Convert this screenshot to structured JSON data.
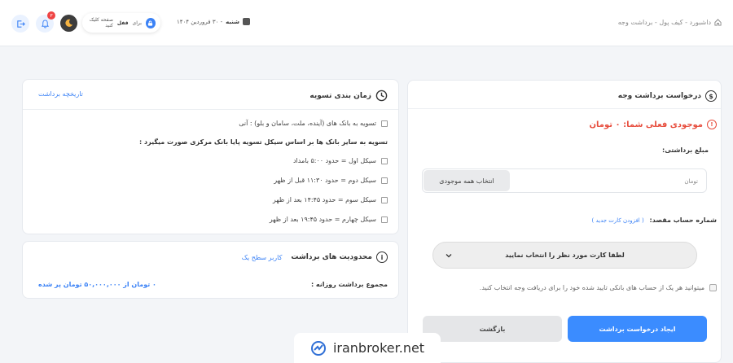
{
  "header": {
    "breadcrumb": "داشبورد - کیف پول - برداشت وجه",
    "date_day": "شنبه",
    "date_rest": "- ۳۰ فروردین ۱۴۰۴",
    "lock_text_pre": "برای",
    "lock_text_bold": "قفل",
    "lock_text_post": "صفحه کلیک کنید",
    "notification_count": "۳"
  },
  "request": {
    "title": "درخواست برداشت وجه",
    "balance": "موجودی فعلی شما: ۰ تومان",
    "amount_label": "مبلغ برداشتی:",
    "amount_unit": "تومان",
    "select_all_label": "انتخاب همه موجودی",
    "dest_label": "شماره حساب مقصد:",
    "add_card": "( افزودن کارت جدید )",
    "card_placeholder": "لطفا کارت مورد نظر را انتخاب نمایید",
    "checkbox_text": "میتوانید هر یک از حساب های بانکی تایید شده خود را برای دریافت وجه انتخاب کنید.",
    "submit_label": "ایجاد درخواست برداشت",
    "back_label": "بازگشت"
  },
  "schedule": {
    "title": "زمان بندی تسویه",
    "history_link": "تاریخچه برداشت",
    "lines": [
      "تسویه به بانک های (آینده، ملت، سامان و بلو) : آنی",
      "تسویه به سایر بانک ها بر اساس سیکل تسویه پایا بانک مرکزی صورت میگیرد :",
      "سیکل اول = حدود ۵:۰۰ بامداد",
      "سیکل دوم = حدود ۱۱:۳۰ قبل از ظهر",
      "سیکل سوم = حدود ۱۴:۴۵ بعد از ظهر",
      "سیکل چهارم = حدود ۱۹:۴۵ بعد از ظهر"
    ]
  },
  "limits": {
    "title": "محدودیت های برداشت",
    "user_level": "کاربر سطح یک",
    "daily_label": "مجموع برداشت روزانه :",
    "daily_value": "۰ تومان از ۵۰,۰۰۰,۰۰۰ تومان پر شده"
  },
  "watermark": {
    "text": "iranbroker.net"
  },
  "colors": {
    "accent": "#3b8cff",
    "danger": "#e74c3c"
  }
}
